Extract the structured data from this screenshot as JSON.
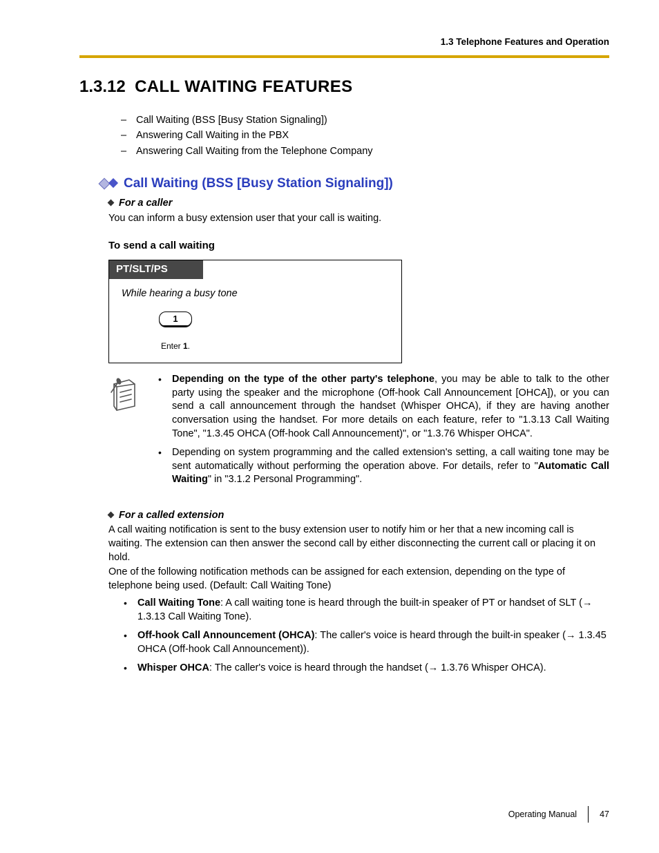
{
  "running_head": "1.3 Telephone Features and Operation",
  "section_number": "1.3.12",
  "section_title": "CALL WAITING FEATURES",
  "dash_items": [
    "Call Waiting (BSS [Busy Station Signaling])",
    "Answering Call Waiting in the PBX",
    "Answering Call Waiting from the Telephone Company"
  ],
  "subhead": "Call Waiting (BSS [Busy Station Signaling])",
  "caller_label": "For a caller",
  "caller_text": "You can inform a busy extension user that your call is waiting.",
  "mini_head": "To send a call waiting",
  "proc_tab": "PT/SLT/PS",
  "proc_cond": "While hearing a busy tone",
  "proc_key": "1",
  "proc_caption_pre": "Enter ",
  "proc_caption_bold": "1",
  "proc_caption_post": ".",
  "note1_bold": "Depending on the type of the other party's telephone",
  "note1_rest": ", you may be able to talk to the other party using the speaker and the microphone (Off-hook Call Announcement [OHCA]), or you can send a call announcement through the handset (Whisper OHCA), if they are having another conversation using the handset. For more details on each feature, refer to \"1.3.13 Call Waiting Tone\", \"1.3.45 OHCA (Off-hook Call Announcement)\", or \"1.3.76 Whisper OHCA\".",
  "note2_pre": "Depending on system programming and the called extension's setting, a call waiting tone may be sent automatically without performing the operation above. For details, refer to \"",
  "note2_bold": "Automatic Call Waiting",
  "note2_post": "\" in \"3.1.2 Personal Programming\".",
  "called_label": "For a called extension",
  "called_p1": "A call waiting notification is sent to the busy extension user to notify him or her that a new incoming call is waiting. The extension can then answer the second call by either disconnecting the current call or placing it on hold.",
  "called_p2": "One of the following notification methods can be assigned for each extension, depending on the type of telephone being used. (Default: Call Waiting Tone)",
  "method1_bold": "Call Waiting Tone",
  "method1_rest": ": A call waiting tone is heard through the built-in speaker of PT or handset of SLT (→ 1.3.13 Call Waiting Tone).",
  "method2_bold": "Off-hook Call Announcement (OHCA)",
  "method2_rest": ": The caller's voice is heard through the built-in speaker (→ 1.3.45 OHCA (Off-hook Call Announcement)).",
  "method3_bold": "Whisper OHCA",
  "method3_rest": ": The caller's voice is heard through the handset (→ 1.3.76 Whisper OHCA).",
  "footer_label": "Operating Manual",
  "footer_page": "47"
}
